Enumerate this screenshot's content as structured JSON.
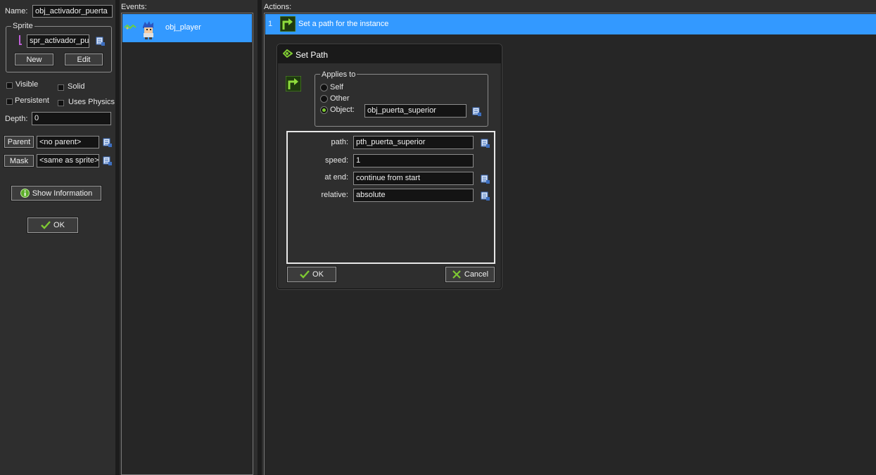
{
  "object_panel": {
    "name_label": "Name:",
    "name_value": "obj_activador_puerta",
    "sprite_group_label": "Sprite",
    "sprite_value": "spr_activador_pue",
    "new_button": "New",
    "edit_button": "Edit",
    "visible_label": "Visible",
    "solid_label": "Solid",
    "persistent_label": "Persistent",
    "uses_physics_label": "Uses Physics",
    "depth_label": "Depth:",
    "depth_value": "0",
    "parent_button": "Parent",
    "parent_value": "<no parent>",
    "mask_button": "Mask",
    "mask_value": "<same as sprite>",
    "show_info_button": "Show Information",
    "ok_button": "OK"
  },
  "events_panel": {
    "header": "Events:",
    "items": [
      {
        "label": "obj_player"
      }
    ]
  },
  "actions_panel": {
    "header": "Actions:",
    "items": [
      {
        "index": "1",
        "label": "Set a path for the instance"
      }
    ]
  },
  "dialog": {
    "title": "Set Path",
    "applies_to_label": "Applies to",
    "options": {
      "self": "Self",
      "other": "Other",
      "object": "Object:"
    },
    "object_value": "obj_puerta_superior",
    "fields": {
      "path": {
        "label": "path:",
        "value": "pth_puerta_superior"
      },
      "speed": {
        "label": "speed:",
        "value": "1"
      },
      "at_end": {
        "label": "at end:",
        "value": "continue from start"
      },
      "relative": {
        "label": "relative:",
        "value": "absolute"
      }
    },
    "ok_button": "OK",
    "cancel_button": "Cancel"
  },
  "colors": {
    "selection": "#3399ff",
    "background": "#2e2e2e",
    "dark_pane": "#262626",
    "accent_green": "#7ec832"
  }
}
